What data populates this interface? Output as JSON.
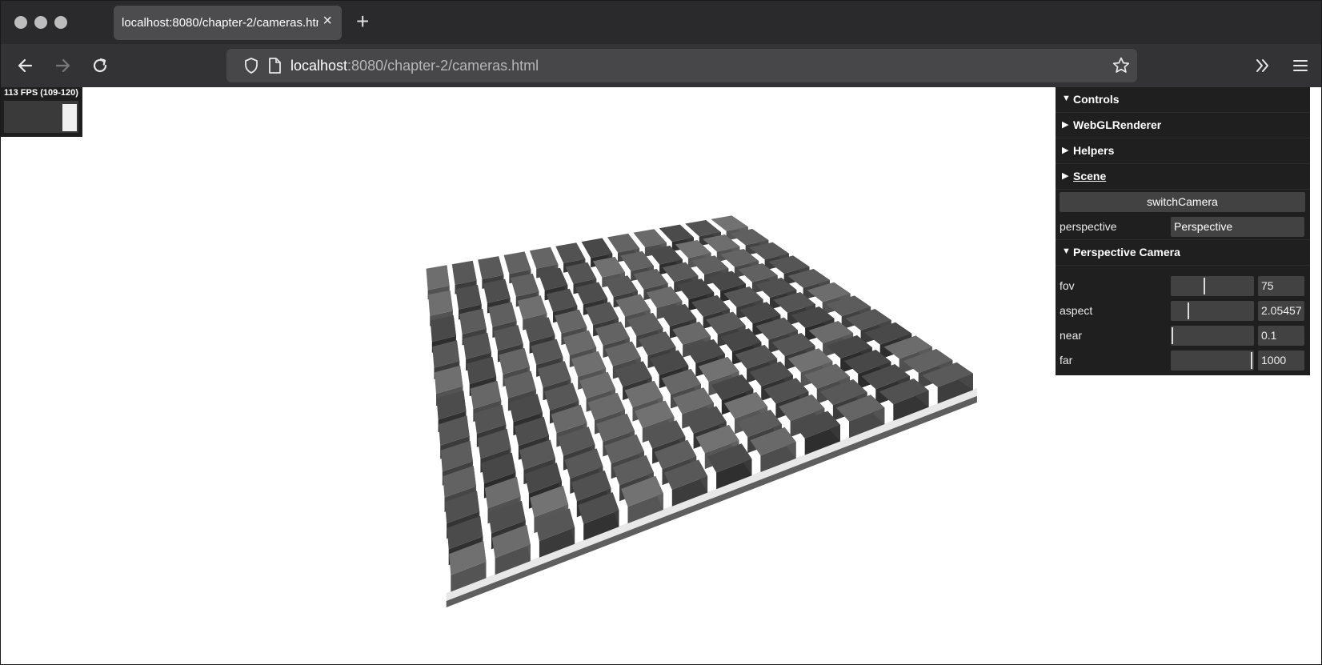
{
  "browser": {
    "tab_title": "localhost:8080/chapter-2/cameras.html",
    "url_host": "localhost",
    "url_rest": ":8080/chapter-2/cameras.html",
    "new_tab_label": "+",
    "tab_close_label": "×"
  },
  "stats": {
    "fps_text": "113 FPS (109-120)",
    "fps_level": 0.94
  },
  "gui": {
    "folders": {
      "controls": "Controls",
      "webgl_renderer": "WebGLRenderer",
      "helpers": "Helpers",
      "scene": "Scene",
      "perspective_camera": "Perspective Camera"
    },
    "switch_camera_label": "switchCamera",
    "perspective_label": "perspective",
    "perspective_value": "Perspective",
    "params": {
      "fov": {
        "label": "fov",
        "value": "75",
        "fraction": 0.4
      },
      "aspect": {
        "label": "aspect",
        "value": "2.05457",
        "fraction": 0.2
      },
      "near": {
        "label": "near",
        "value": "0.1",
        "fraction": 0.0
      },
      "far": {
        "label": "far",
        "value": "1000",
        "fraction": 1.0
      }
    }
  },
  "colors": {
    "chrome_dark": "#2a2a2c",
    "toolbar": "#333335",
    "panel_bg": "#1f1f1f",
    "control_bg": "#424242"
  }
}
